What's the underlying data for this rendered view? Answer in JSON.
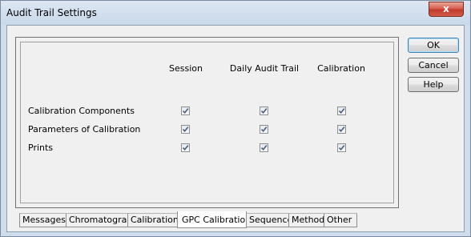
{
  "window": {
    "title": "Audit Trail Settings",
    "close_glyph": "x"
  },
  "columns": [
    "Session",
    "Daily Audit Trail",
    "Calibration"
  ],
  "rows": [
    {
      "label": "Calibration Components",
      "checked": [
        true,
        true,
        true
      ]
    },
    {
      "label": "Parameters of Calibration",
      "checked": [
        true,
        true,
        true
      ]
    },
    {
      "label": "Prints",
      "checked": [
        true,
        true,
        true
      ]
    }
  ],
  "buttons": {
    "ok": "OK",
    "cancel": "Cancel",
    "help": "Help"
  },
  "tabs": [
    {
      "label": "Messages",
      "active": false
    },
    {
      "label": "Chromatogram",
      "active": false
    },
    {
      "label": "Calibration",
      "active": false
    },
    {
      "label": "GPC Calibration",
      "active": true
    },
    {
      "label": "Sequence",
      "active": false
    },
    {
      "label": "Method",
      "active": false
    },
    {
      "label": "Other",
      "active": false
    }
  ],
  "colors": {
    "checkmark": "#4a5d7a",
    "title_bar": "#cfdcec",
    "close_button": "#c9483a"
  }
}
